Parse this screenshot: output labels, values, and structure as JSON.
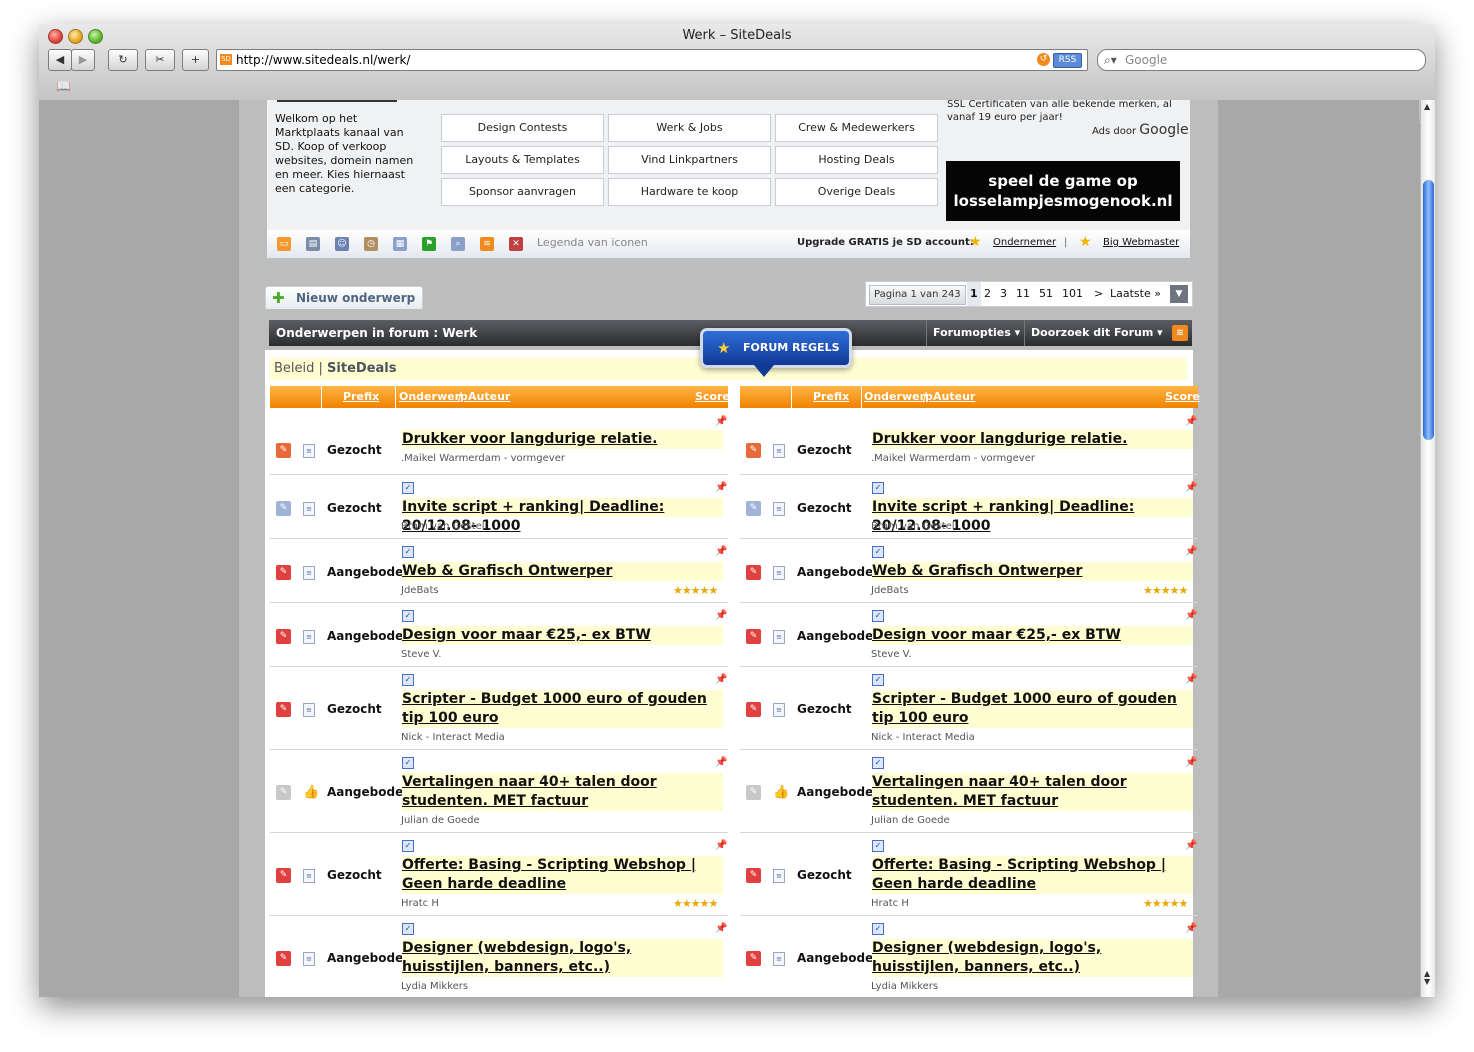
{
  "window": {
    "title": "Werk – SiteDeals",
    "url": "http://www.sitedeals.nl/werk/",
    "rss_label": "RSS",
    "search_placeholder": "Google",
    "favicon_text": "SD"
  },
  "header": {
    "welcome": "Welkom op het Marktplaats kanaal van SD. Koop of verkoop websites, domein namen en meer. Kies hiernaast een categorie.",
    "categories": [
      "Design Contests",
      "Werk & Jobs",
      "Crew & Medewerkers",
      "Layouts & Templates",
      "Vind Linkpartners",
      "Hosting Deals",
      "Sponsor aanvragen",
      "Hardware te koop",
      "Overige Deals"
    ],
    "ssl_ad": "SSL Certificaten van alle bekende merken, al vanaf 19 euro per jaar!",
    "ads_by": "Ads door",
    "ads_brand": "Google",
    "game_line1": "speel de game op",
    "game_line2": "losselampjesmogenook.nl"
  },
  "iconbar": {
    "legenda": "Legenda van iconen",
    "upgrade": "Upgrade GRATIS je SD account:",
    "ondernemer": "Ondernemer",
    "separator": "|",
    "big_webmaster": "Big Webmaster"
  },
  "toolbar": {
    "new_topic": "Nieuw onderwerp",
    "page_label": "Pagina 1 van 243",
    "pages": [
      "1",
      "2",
      "3",
      "11",
      "51",
      "101",
      ">",
      "Laatste »"
    ]
  },
  "forum": {
    "title": "Onderwerpen in forum : Werk",
    "forumopties": "Forumopties ▾",
    "doorzoek": "Doorzoek dit Forum ▾",
    "rules": "FORUM REGELS",
    "beleid_prefix": "Beleid |",
    "beleid_name": "SiteDeals",
    "col_headers": {
      "prefix": "Prefix",
      "onderwerp": "Onderwerp",
      "slash": "/",
      "auteur": "Auteur",
      "score": "Score"
    }
  },
  "threads": [
    {
      "prefix": "Gezocht",
      "title": "Drukker voor langdurige relatie.",
      "author": ".Maikel Warmerdam - vormgever",
      "stars": "",
      "checked": false
    },
    {
      "prefix": "Gezocht",
      "title": "Invite script + ranking| Deadline: 20/12.08- 1000",
      "author": "Bram van Gestel",
      "stars": "",
      "checked": true
    },
    {
      "prefix": "Aangeboden",
      "title": "Web & Grafisch Ontwerper",
      "author": "JdeBats",
      "stars": "★★★★★",
      "checked": true
    },
    {
      "prefix": "Aangeboden",
      "title": "Design voor maar €25,- ex BTW",
      "author": "Steve V.",
      "stars": "",
      "checked": true
    },
    {
      "prefix": "Gezocht",
      "title": "Scripter - Budget 1000 euro of gouden tip 100 euro",
      "author": "Nick - Interact Media",
      "stars": "",
      "checked": true
    },
    {
      "prefix": "Aangeboden",
      "title": "Vertalingen naar 40+ talen door studenten. MET factuur",
      "author": "Julian de Goede",
      "stars": "",
      "checked": true
    },
    {
      "prefix": "Gezocht",
      "title": "Offerte: Basing - Scripting Webshop | Geen harde deadline",
      "author": "Hratc H",
      "stars": "★★★★★",
      "checked": true
    },
    {
      "prefix": "Aangeboden",
      "title": "Designer (webdesign, logo's, huisstijlen, banners, etc..)",
      "author": "Lydia Mikkers",
      "stars": "",
      "checked": true
    }
  ],
  "colors": {
    "orange": "#f08200",
    "highlight": "#fffdd2",
    "dark_header": "#2a2c30",
    "rules_blue": "#103a94"
  }
}
